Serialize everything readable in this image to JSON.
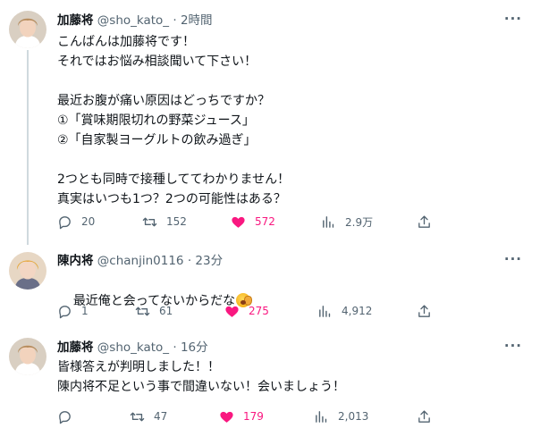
{
  "tweets": [
    {
      "name": "加藤将",
      "handle": "@sho_kato_",
      "time": "2時間",
      "text": "こんばんは加藤将です！\nそれではお悩み相談聞いて下さい！\n\n最近お腹が痛い原因はどっちですか？\n①「賞味期限切れの野菜ジュース」\n②「自家製ヨーグルトの飲み過ぎ」\n\n2つとも同時で接種しててわかりません！\n真実はいつも1つ？2つの可能性はある？",
      "replies": "20",
      "retweets": "152",
      "likes": "572",
      "views": "2.9万"
    },
    {
      "name": "陳内将",
      "handle": "@chanjin0116",
      "time": "23分",
      "text": "最近俺と会ってないからだな",
      "emoji": "yawning-face-emoji",
      "replies": "1",
      "retweets": "61",
      "likes": "275",
      "views": "4,912"
    },
    {
      "name": "加藤将",
      "handle": "@sho_kato_",
      "time": "16分",
      "text": "皆様答えが判明しました！！\n陳内将不足という事で間違いない！会いましょう！",
      "replies": "",
      "retweets": "47",
      "likes": "179",
      "views": "2,013"
    }
  ],
  "icons": {
    "reply": "reply-icon",
    "retweet": "retweet-icon",
    "like": "heart-icon",
    "views": "views-icon",
    "share": "share-icon",
    "more": "more-icon"
  },
  "colors": {
    "like_active": "#f91880",
    "secondary_text": "#536471",
    "thread_line": "#cfd9de"
  },
  "more_glyph": "···",
  "separator": " · "
}
